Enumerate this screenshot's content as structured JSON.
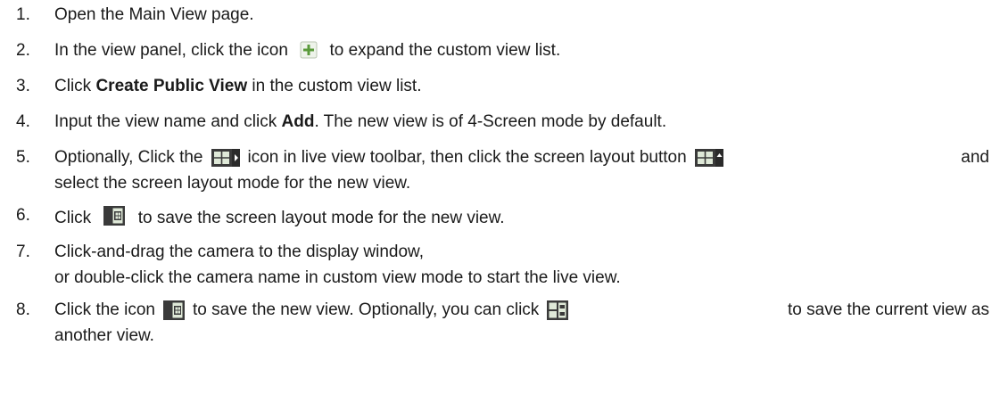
{
  "steps": [
    {
      "num": "1.",
      "text": "Open the Main View page."
    },
    {
      "num": "2.",
      "before": "In the view panel, click the icon",
      "icon": "expand-plus-icon",
      "after": "to expand the custom view list."
    },
    {
      "num": "3.",
      "before": "Click",
      "bold": "Create Public View",
      "after": "in the custom view list."
    },
    {
      "num": "4.",
      "before": "Input the view name and click",
      "bold": "Add",
      "after": ". The new view is of 4-Screen mode by default."
    },
    {
      "num": "5.",
      "line1": {
        "p1": "Optionally, Click the",
        "icon1": "screen-layout-toolbar-icon",
        "p2": "icon in live view toolbar, then click the screen layout button",
        "icon2": "screen-layout-button-icon",
        "p3": "and"
      },
      "line2": "select the screen layout mode for the new view."
    },
    {
      "num": "6.",
      "before": "Click",
      "icon": "save-layout-icon",
      "after": "to save the screen layout mode for the new view."
    },
    {
      "num": "7.",
      "line1": "Click-and-drag the camera to the display window,",
      "line2": "or double-click the camera name in custom view mode to start the live view."
    },
    {
      "num": "8.",
      "line1": {
        "p1": "Click the icon",
        "icon1": "save-view-icon",
        "p2": "to save the new view. Optionally, you can click",
        "icon2": "save-as-view-icon",
        "p3": "to save the current view as"
      },
      "line2": "another view."
    }
  ],
  "colors": {
    "text": "#1a1a1a",
    "icon_frame": "#3a3a3a",
    "icon_fill": "#dfe9d8",
    "plus": "#4a8a2a"
  }
}
